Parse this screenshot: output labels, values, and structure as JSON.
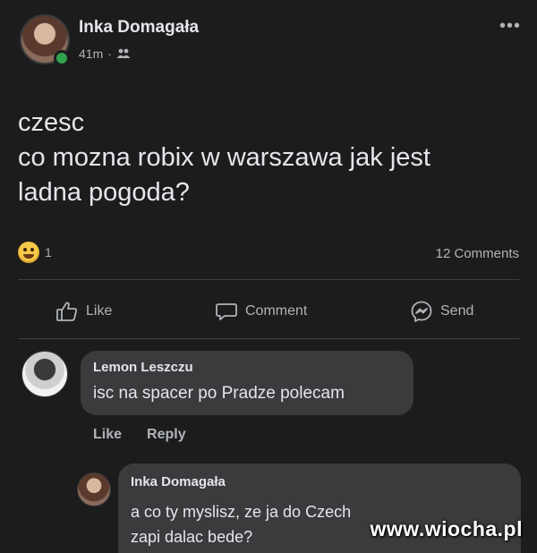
{
  "post": {
    "author": "Inka Domagała",
    "time": "41m",
    "separator": "·",
    "audience_icon": "friends-icon",
    "more_label": "•••",
    "text_lines": [
      "czesc",
      "co mozna robix w warszawa jak jest",
      "ladna pogoda?"
    ],
    "reaction_count": "1",
    "comments_count": "12 Comments"
  },
  "actions": {
    "like": "Like",
    "comment": "Comment",
    "send": "Send"
  },
  "comments": [
    {
      "author": "Lemon Leszczu",
      "text": "isc na spacer po Pradze polecam",
      "like_label": "Like",
      "reply_label": "Reply"
    },
    {
      "author": "Inka Domagała",
      "text_line1": "a co ty myslisz, ze ja do Czech",
      "text_line2": "zapi dalac bede?"
    }
  ],
  "watermark": "www.wiocha.pl",
  "colors": {
    "background": "#1c1c1d",
    "bubble": "#3a3b3c",
    "online": "#31a24c",
    "muted": "#b0b3b8"
  }
}
